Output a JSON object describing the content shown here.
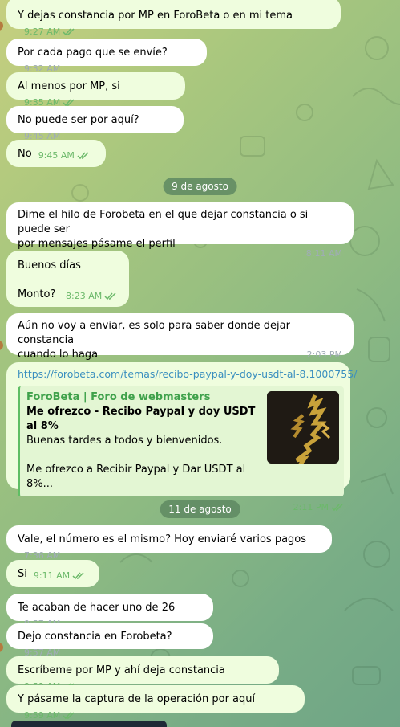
{
  "messages": [
    {
      "text": "Y dejas constancia por MP en ForoBeta o en mi tema",
      "time": "9:27 AM"
    },
    {
      "text": "Por cada pago que se envíe?",
      "time": "9:32 AM"
    },
    {
      "text": "Al menos por MP, si",
      "time": "9:35 AM"
    },
    {
      "text": "No puede ser por aquí?",
      "time": "9:45 AM"
    },
    {
      "text": "No",
      "time": "9:45 AM"
    },
    {
      "text": "Dime el hilo de Forobeta en el que dejar constancia o si puede ser\npor mensajes pásame el perfil",
      "time": "8:11 AM"
    },
    {
      "text": "Buenos días\n\nMonto?",
      "time": "8:23 AM"
    },
    {
      "text": "Aún no voy a enviar, es solo para saber donde dejar constancia\ncuando lo haga",
      "time": "2:03 PM"
    },
    {
      "text": "Vale, el número es el mismo? Hoy enviaré varios pagos",
      "time": "7:36 AM"
    },
    {
      "text": "Si",
      "time": "9:11 AM"
    },
    {
      "text": "Te acaban de hacer uno de 26",
      "time": "9:57 AM"
    },
    {
      "text": "Dejo constancia en Forobeta?",
      "time": "9:57 AM"
    },
    {
      "text": "Escríbeme por MP y ahí deja constancia",
      "time": "9:59 AM"
    },
    {
      "text": "Y pásame la captura de la operación por aquí",
      "time": "9:59 AM"
    }
  ],
  "dates": [
    "9 de agosto",
    "11 de agosto"
  ],
  "link_message": {
    "url": "https://forobeta.com/temas/recibo-paypal-y-doy-usdt-al-8.1000755/",
    "site_name": "ForoBeta | Foro de webmasters",
    "title": "Me ofrezco - Recibo Paypal y doy USDT al 8%",
    "description": "Buenas tardes a todos y bienvenidos.\n\nMe ofrezco a Recibir Paypal y Dar USDT al 8%...",
    "time": "2:11 PM"
  },
  "icons": {
    "read": "double-check-icon",
    "thumbnail": "preview-thumbnail-image"
  },
  "colors": {
    "incoming": "#ffffff",
    "outgoing": "#effdde",
    "accent": "#5fbe64",
    "link": "#3a8fbf",
    "date_pill": "#5e8862"
  }
}
